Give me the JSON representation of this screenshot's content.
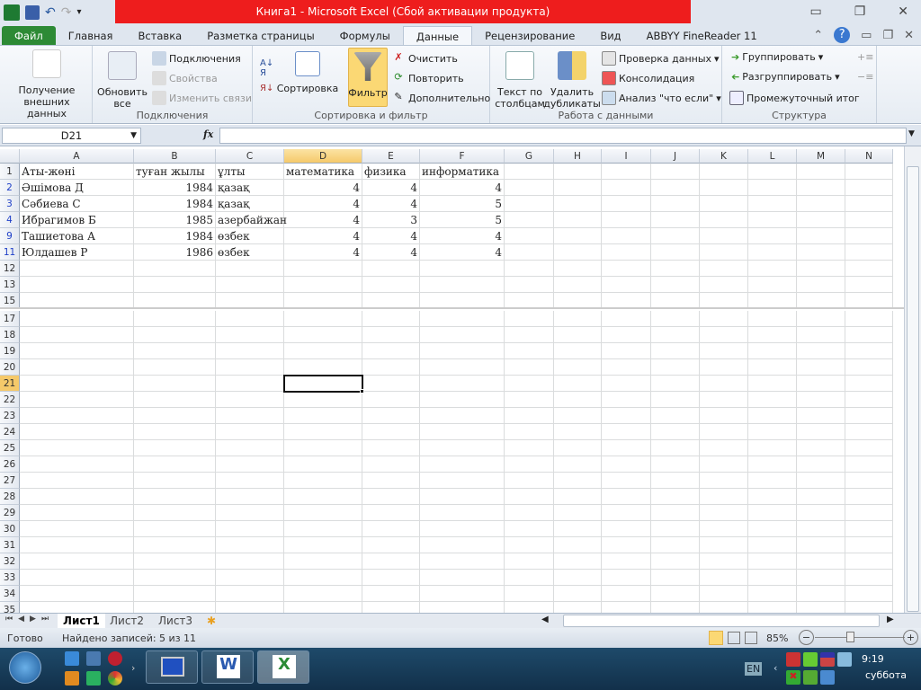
{
  "window": {
    "title": "Книга1  -  Microsoft Excel (Сбой активации продукта)"
  },
  "tabs": [
    "Файл",
    "Главная",
    "Вставка",
    "Разметка страницы",
    "Формулы",
    "Данные",
    "Рецензирование",
    "Вид",
    "ABBYY FineReader 11"
  ],
  "active_tab": "Данные",
  "ribbon": {
    "get_external": "Получение\nвнешних данных",
    "refresh_all": "Обновить\nвсе",
    "connections": "Подключения",
    "properties": "Свойства",
    "edit_links": "Изменить связи",
    "group_connections": "Подключения",
    "sort": "Сортировка",
    "filter": "Фильтр",
    "clear": "Очистить",
    "reapply": "Повторить",
    "advanced": "Дополнительно",
    "group_sort": "Сортировка и фильтр",
    "text_to_columns": "Текст по\nстолбцам",
    "remove_duplicates": "Удалить\nдубликаты",
    "data_validation": "Проверка данных",
    "consolidate": "Консолидация",
    "what_if": "Анализ \"что если\"",
    "group_data": "Работа с данными",
    "group": "Группировать",
    "ungroup": "Разгруппировать",
    "subtotal": "Промежуточный итог",
    "group_outline": "Структура"
  },
  "formula_bar": {
    "name_box": "D21",
    "fx": "fx",
    "formula": ""
  },
  "columns": [
    "A",
    "B",
    "C",
    "D",
    "E",
    "F",
    "G",
    "H",
    "I",
    "J",
    "K",
    "L",
    "M",
    "N"
  ],
  "rows": [
    {
      "n": "1",
      "cells": [
        "Аты-жөні",
        "туған жылы",
        "ұлты",
        "математика",
        "физика",
        "информатика"
      ]
    },
    {
      "n": "2",
      "cells": [
        "Әшімова Д",
        "1984",
        "қазақ",
        "4",
        "4",
        "4"
      ]
    },
    {
      "n": "3",
      "cells": [
        "Сәбиева С",
        "1984",
        "қазақ",
        "4",
        "4",
        "5"
      ]
    },
    {
      "n": "4",
      "cells": [
        "Ибрагимов Б",
        "1985",
        "азербайжан",
        "4",
        "3",
        "5"
      ]
    },
    {
      "n": "9",
      "cells": [
        "Ташиетова А",
        "1984",
        "өзбек",
        "4",
        "4",
        "4"
      ]
    },
    {
      "n": "11",
      "cells": [
        "Юлдашев Р",
        "1986",
        "өзбек",
        "4",
        "4",
        "4"
      ]
    },
    {
      "n": "12",
      "cells": []
    },
    {
      "n": "13",
      "cells": []
    },
    {
      "n": "15",
      "cells": []
    },
    {
      "n": "17",
      "cells": []
    },
    {
      "n": "18",
      "cells": []
    },
    {
      "n": "19",
      "cells": []
    },
    {
      "n": "20",
      "cells": []
    },
    {
      "n": "21",
      "cells": []
    },
    {
      "n": "22",
      "cells": []
    },
    {
      "n": "23",
      "cells": []
    },
    {
      "n": "24",
      "cells": []
    },
    {
      "n": "25",
      "cells": []
    },
    {
      "n": "26",
      "cells": []
    },
    {
      "n": "27",
      "cells": []
    },
    {
      "n": "28",
      "cells": []
    },
    {
      "n": "29",
      "cells": []
    },
    {
      "n": "30",
      "cells": []
    },
    {
      "n": "31",
      "cells": []
    },
    {
      "n": "32",
      "cells": []
    },
    {
      "n": "33",
      "cells": []
    },
    {
      "n": "34",
      "cells": []
    },
    {
      "n": "35",
      "cells": []
    }
  ],
  "selected_cell": "D21",
  "filtered_column": "D",
  "sheets": [
    "Лист1",
    "Лист2",
    "Лист3"
  ],
  "active_sheet": "Лист1",
  "status": {
    "ready": "Готово",
    "found": "Найдено записей: 5 из 11",
    "zoom": "85%",
    "zoom_minus": "−",
    "zoom_plus": "+"
  },
  "taskbar": {
    "lang": "EN",
    "time": "9:19",
    "day": "суббота",
    "chevron": "›",
    "tray_chevron": "‹"
  },
  "colors": {
    "titlebar": "#ee1d1d",
    "file_tab": "#2d8a35",
    "filter_active": "#fbd874",
    "taskbar": "#1e4a6a"
  }
}
